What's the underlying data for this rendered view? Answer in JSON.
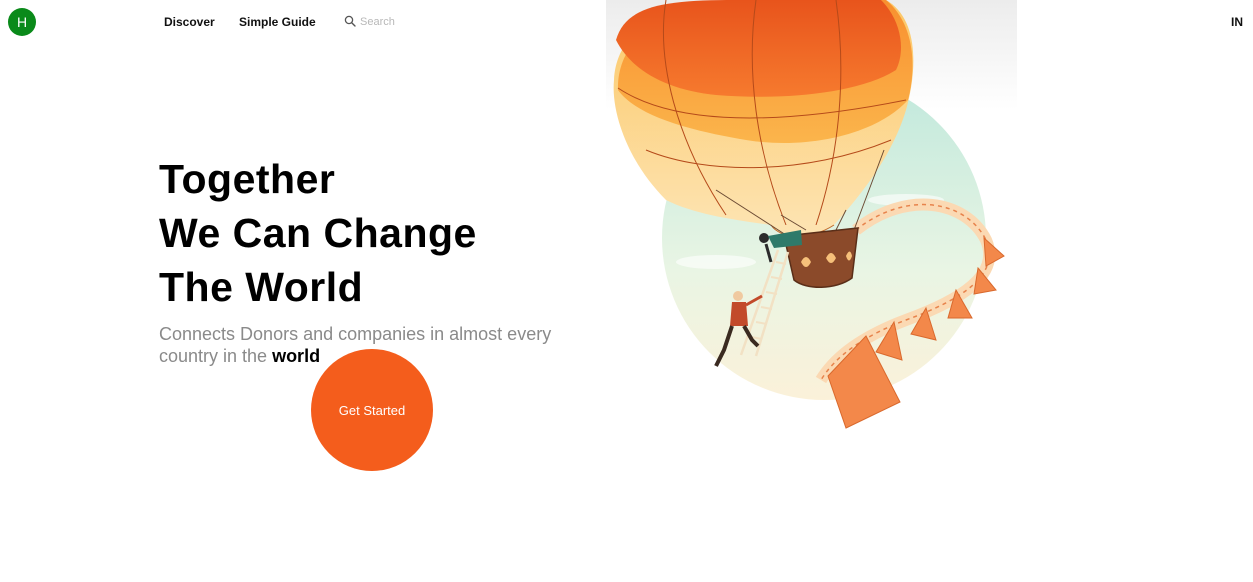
{
  "nav": {
    "logo_letter": "H",
    "links": [
      "Discover",
      "Simple Guide"
    ],
    "search_placeholder": "Search",
    "lang": "IN"
  },
  "hero": {
    "headline": [
      "Together",
      "We Can Change",
      "The World"
    ],
    "subtitle_prefix": "Connects Donors and companies in almost every country in the ",
    "subtitle_accent": "world",
    "cta_label": "Get Started"
  },
  "colors": {
    "logo": "#0a8a1a",
    "cta": "#f45d1c",
    "balloon_top": "#f26a24",
    "balloon_mid": "#f9a23e",
    "sky": "#cfeee3"
  },
  "illustration": {
    "icon": "hot-air-balloon-illustration"
  }
}
